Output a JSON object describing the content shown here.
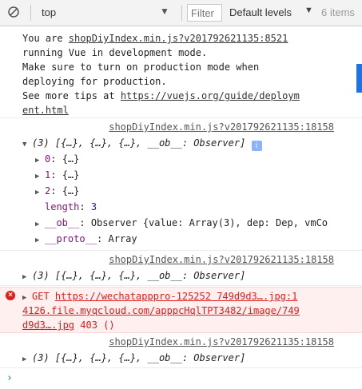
{
  "toolbar": {
    "context": "top",
    "filter_placeholder": "Filter",
    "levels": "Default levels",
    "issues": "6 items"
  },
  "messages": {
    "vue": {
      "l1a": "You are ",
      "l1src": "shopDiyIndex.min.js?v201792621135:8521",
      "l2": "running Vue in development mode.",
      "l3": "Make sure to turn on production mode when",
      "l4": "deploying for production.",
      "l5a": "See more tips at ",
      "l5link": "https://vuejs.org/guide/deploym",
      "l6link": "ent.html"
    },
    "log1": {
      "source": "shopDiyIndex.min.js?v201792621135:18158",
      "summary": "(3) [{…}, {…}, {…}, __ob__: Observer]",
      "info": "i",
      "items": [
        {
          "key": "0",
          "value": "{…}"
        },
        {
          "key": "1",
          "value": "{…}"
        },
        {
          "key": "2",
          "value": "{…}"
        }
      ],
      "length_key": "length",
      "length_value": "3",
      "ob_key": "__ob__",
      "ob_value": "Observer {value: Array(3), dep: Dep, vmCo",
      "proto_key": "__proto__",
      "proto_value": "Array"
    },
    "log2": {
      "source": "shopDiyIndex.min.js?v201792621135:18158",
      "summary": "(3) [{…}, {…}, {…}, __ob__: Observer]"
    },
    "error": {
      "icon": "×",
      "l1a": "GET ",
      "l1link": "https://wechatapppro-125252 749d9d3….jpg:1",
      "l2link": "4126.file.myqcloud.com/apppcHqlTPT3482/image/749",
      "l3link": "d9d3….jpg",
      "status": " 403 ()"
    },
    "log3": {
      "source": "shopDiyIndex.min.js?v201792621135:18158",
      "summary": "(3) [{…}, {…}, {…}, __ob__: Observer]"
    }
  },
  "prompt": "›"
}
